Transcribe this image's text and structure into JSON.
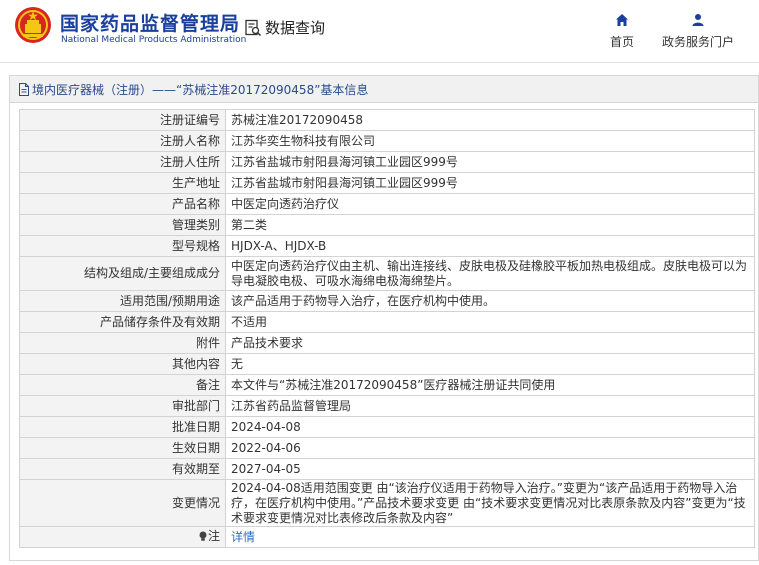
{
  "header": {
    "brand_cn": "国家药品监督管理局",
    "brand_en": "National Medical Products Administration",
    "data_query": "数据查询",
    "nav": [
      {
        "label": "首页",
        "icon": "home-icon"
      },
      {
        "label": "政务服务门户",
        "icon": "user-icon"
      }
    ]
  },
  "panel": {
    "title": "境内医疗器械（注册）——“苏械注准20172090458”基本信息"
  },
  "rows": [
    {
      "key": "注册证编号",
      "value": "苏械注准20172090458"
    },
    {
      "key": "注册人名称",
      "value": "江苏华奕生物科技有限公司"
    },
    {
      "key": "注册人住所",
      "value": "江苏省盐城市射阳县海河镇工业园区999号"
    },
    {
      "key": "生产地址",
      "value": "江苏省盐城市射阳县海河镇工业园区999号"
    },
    {
      "key": "产品名称",
      "value": "中医定向透药治疗仪"
    },
    {
      "key": "管理类别",
      "value": "第二类"
    },
    {
      "key": "型号规格",
      "value": "HJDX-A、HJDX-B"
    },
    {
      "key": "结构及组成/主要组成成分",
      "value": "中医定向透药治疗仪由主机、输出连接线、皮肤电极及硅橡胶平板加热电极组成。皮肤电极可以为导电凝胶电极、可吸水海绵电极海绵垫片。"
    },
    {
      "key": "适用范围/预期用途",
      "value": "该产品适用于药物导入治疗，在医疗机构中使用。"
    },
    {
      "key": "产品储存条件及有效期",
      "value": "不适用"
    },
    {
      "key": "附件",
      "value": "产品技术要求"
    },
    {
      "key": "其他内容",
      "value": "无"
    },
    {
      "key": "备注",
      "value": "本文件与“苏械注准20172090458”医疗器械注册证共同使用"
    },
    {
      "key": "审批部门",
      "value": "江苏省药品监督管理局"
    },
    {
      "key": "批准日期",
      "value": "2024-04-08"
    },
    {
      "key": "生效日期",
      "value": "2022-04-06"
    },
    {
      "key": "有效期至",
      "value": "2027-04-05"
    },
    {
      "key": "变更情况",
      "value": "2024-04-08适用范围变更 由“该治疗仪适用于药物导入治疗。”变更为“该产品适用于药物导入治疗，在医疗机构中使用。”产品技术要求变更 由“技术要求变更情况对比表原条款及内容”变更为“技术要求变更情况对比表修改后条款及内容”"
    }
  ],
  "note": {
    "key": "注",
    "link": "详情",
    "icon": "lightbulb-icon"
  }
}
